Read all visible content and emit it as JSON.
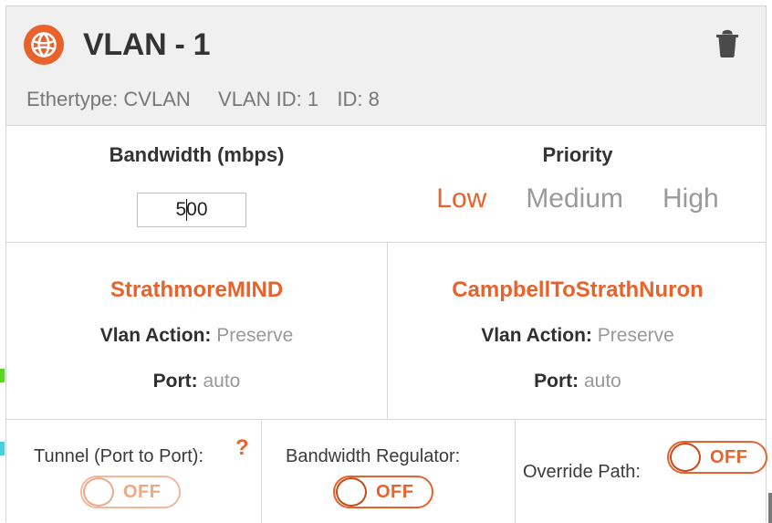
{
  "header": {
    "icon": "network-globe-icon",
    "title": "VLAN - 1",
    "delete_icon": "trash-icon",
    "meta": {
      "ethertype_label": "Ethertype:",
      "ethertype_value": "CVLAN",
      "vlan_id_label": "VLAN ID:",
      "vlan_id_value": "1",
      "id_label": "ID:",
      "id_value": "8"
    }
  },
  "config": {
    "bandwidth": {
      "label": "Bandwidth (mbps)",
      "value": "500"
    },
    "priority": {
      "label": "Priority",
      "options": [
        {
          "label": "Low",
          "selected": true
        },
        {
          "label": "Medium",
          "selected": false
        },
        {
          "label": "High",
          "selected": false
        }
      ],
      "selected": "Low"
    }
  },
  "endpoints": [
    {
      "name": "StrathmoreMIND",
      "vlan_action_label": "Vlan Action:",
      "vlan_action_value": "Preserve",
      "port_label": "Port:",
      "port_value": "auto"
    },
    {
      "name": "CampbellToStrathNuron",
      "vlan_action_label": "Vlan Action:",
      "vlan_action_value": "Preserve",
      "port_label": "Port:",
      "port_value": "auto"
    }
  ],
  "toggles": [
    {
      "label": "Tunnel (Port to Port):",
      "state": "OFF",
      "help_icon": "?",
      "disabled": true
    },
    {
      "label": "Bandwidth Regulator:",
      "state": "OFF",
      "disabled": false
    },
    {
      "label": "Override Path:",
      "state": "OFF",
      "disabled": false
    }
  ],
  "colors": {
    "accent": "#e8622c",
    "accent_faded": "#f3b79b",
    "header_bg": "#f0f0f0",
    "border": "#d6d6d6",
    "muted_text": "#999999",
    "marker_green": "#5ed428",
    "marker_cyan": "#4ad0dd"
  }
}
